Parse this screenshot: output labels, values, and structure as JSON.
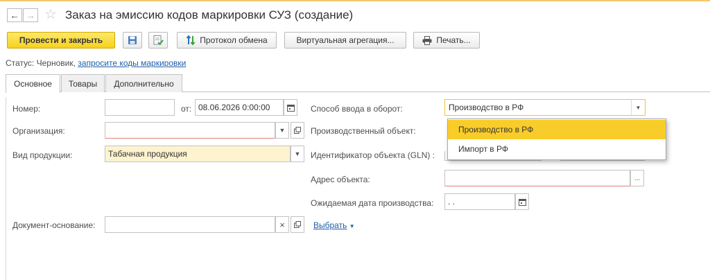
{
  "window": {
    "title": "Заказ на эмиссию кодов маркировки СУЗ (создание)"
  },
  "nav": {
    "back_icon": "arrow-left",
    "forward_icon": "arrow-right",
    "favorite_icon": "star-outline"
  },
  "toolbar": {
    "post_close_label": "Провести и закрыть",
    "save_icon": "floppy-disk",
    "post_icon": "post-document",
    "exchange_log_label": "Протокол обмена",
    "virtual_aggregation_label": "Виртуальная агрегация...",
    "print_label": "Печать..."
  },
  "status": {
    "prefix": "Статус: Черновик,",
    "link": "запросите коды маркировки"
  },
  "tabs": [
    {
      "label": "Основное",
      "active": true
    },
    {
      "label": "Товары",
      "active": false
    },
    {
      "label": "Дополнительно",
      "active": false
    }
  ],
  "form": {
    "number_label": "Номер:",
    "number_value": "",
    "date_label": "от:",
    "date_value": "08.06.2026  0:00:00",
    "organization_label": "Организация:",
    "organization_value": "",
    "product_type_label": "Вид продукции:",
    "product_type_value": "Табачная продукция",
    "base_doc_label": "Документ-основание:",
    "base_doc_value": "",
    "select_link": "Выбрать",
    "entry_method_label": "Способ ввода в оборот:",
    "entry_method_value": "Производство в РФ",
    "production_object_label": "Производственный объект:",
    "object_id_label": "Идентификатор объекта (GLN) :",
    "object_address_label": "Адрес объекта:",
    "object_address_value": "",
    "expected_date_label": "Ожидаемая дата производства:",
    "expected_date_value": " .  .",
    "clear_symbol": "×",
    "ellipsis_symbol": "..."
  },
  "dropdown": {
    "options": [
      "Производство в РФ",
      "Импорт в РФ"
    ],
    "selected": "Производство в РФ"
  },
  "colors": {
    "primary_button": "#f7d21b",
    "selected_option": "#f8cd2a",
    "link": "#1d5ea8",
    "required_underline": "#e2807a",
    "focus_border": "#f3c040"
  }
}
